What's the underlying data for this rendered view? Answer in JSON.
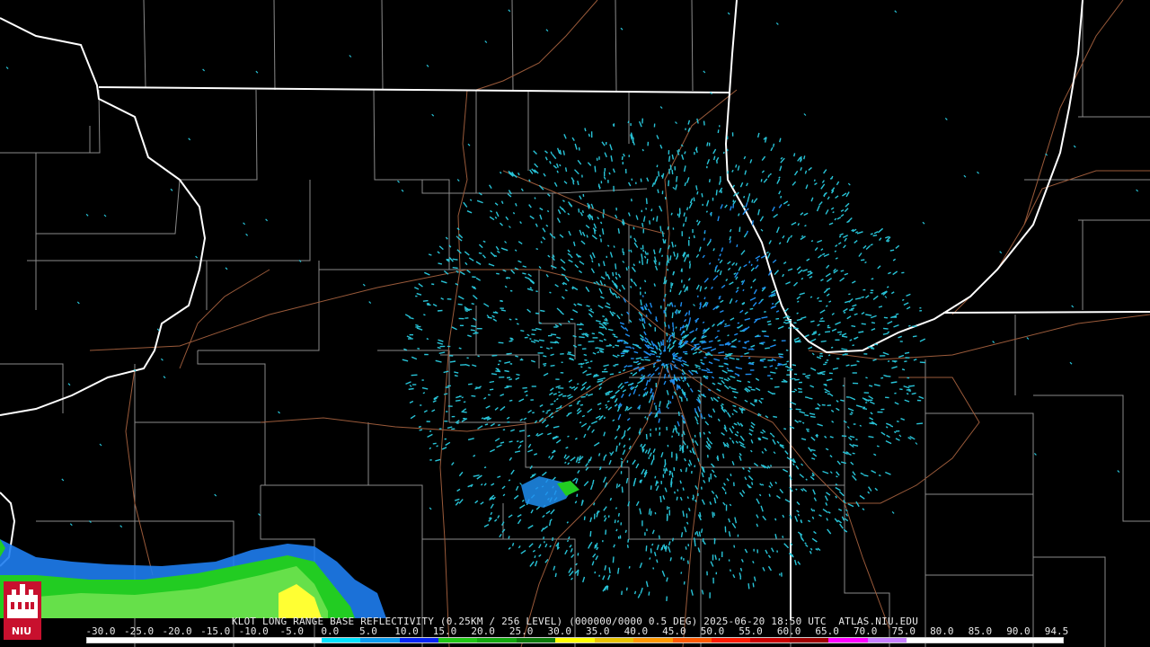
{
  "product": {
    "caption": "KLOT LONG RANGE BASE REFLECTIVITY (0.25KM / 256 LEVEL) (000000/0000 0.5 DEG) 2025-06-20 18:50 UTC  ATLAS.NIU.EDU",
    "station": "KLOT",
    "datetime": "2025-06-20 18:50 UTC",
    "elevation": "0.5 DEG",
    "source": "ATLAS.NIU.EDU"
  },
  "logo": {
    "text": "NIU",
    "icon": "niu-castle-logo-icon"
  },
  "scale": {
    "labels": [
      "-30.0",
      "-25.0",
      "-20.0",
      "-15.0",
      "-10.0",
      "-5.0",
      "0.0",
      "5.0",
      "10.0",
      "15.0",
      "20.0",
      "25.0",
      "30.0",
      "35.0",
      "40.0",
      "45.0",
      "50.0",
      "55.0",
      "60.0",
      "65.0",
      "70.0",
      "75.0",
      "80.0",
      "85.0",
      "90.0",
      "94.5"
    ],
    "colors": [
      "#ffffff",
      "#ffffff",
      "#ffffff",
      "#ffffff",
      "#ffffff",
      "#ffffff",
      "#00e3ff",
      "#0a9cf0",
      "#0524f5",
      "#1fc714",
      "#11a80d",
      "#0b7a08",
      "#ffff00",
      "#e8c400",
      "#ff9900",
      "#ff5a00",
      "#ff1a00",
      "#cc0000",
      "#a00000",
      "#ff00ff",
      "#c880ff",
      "#ffffff",
      "#ffffff",
      "#ffffff",
      "#ffffff"
    ]
  },
  "colors": {
    "background": "#000000",
    "state_border": "#ffffff",
    "county_border": "#8a8a8a",
    "highway": "#9a5a3a",
    "echo_light": "#28c4d8",
    "echo_med": "#1e8ef0"
  }
}
